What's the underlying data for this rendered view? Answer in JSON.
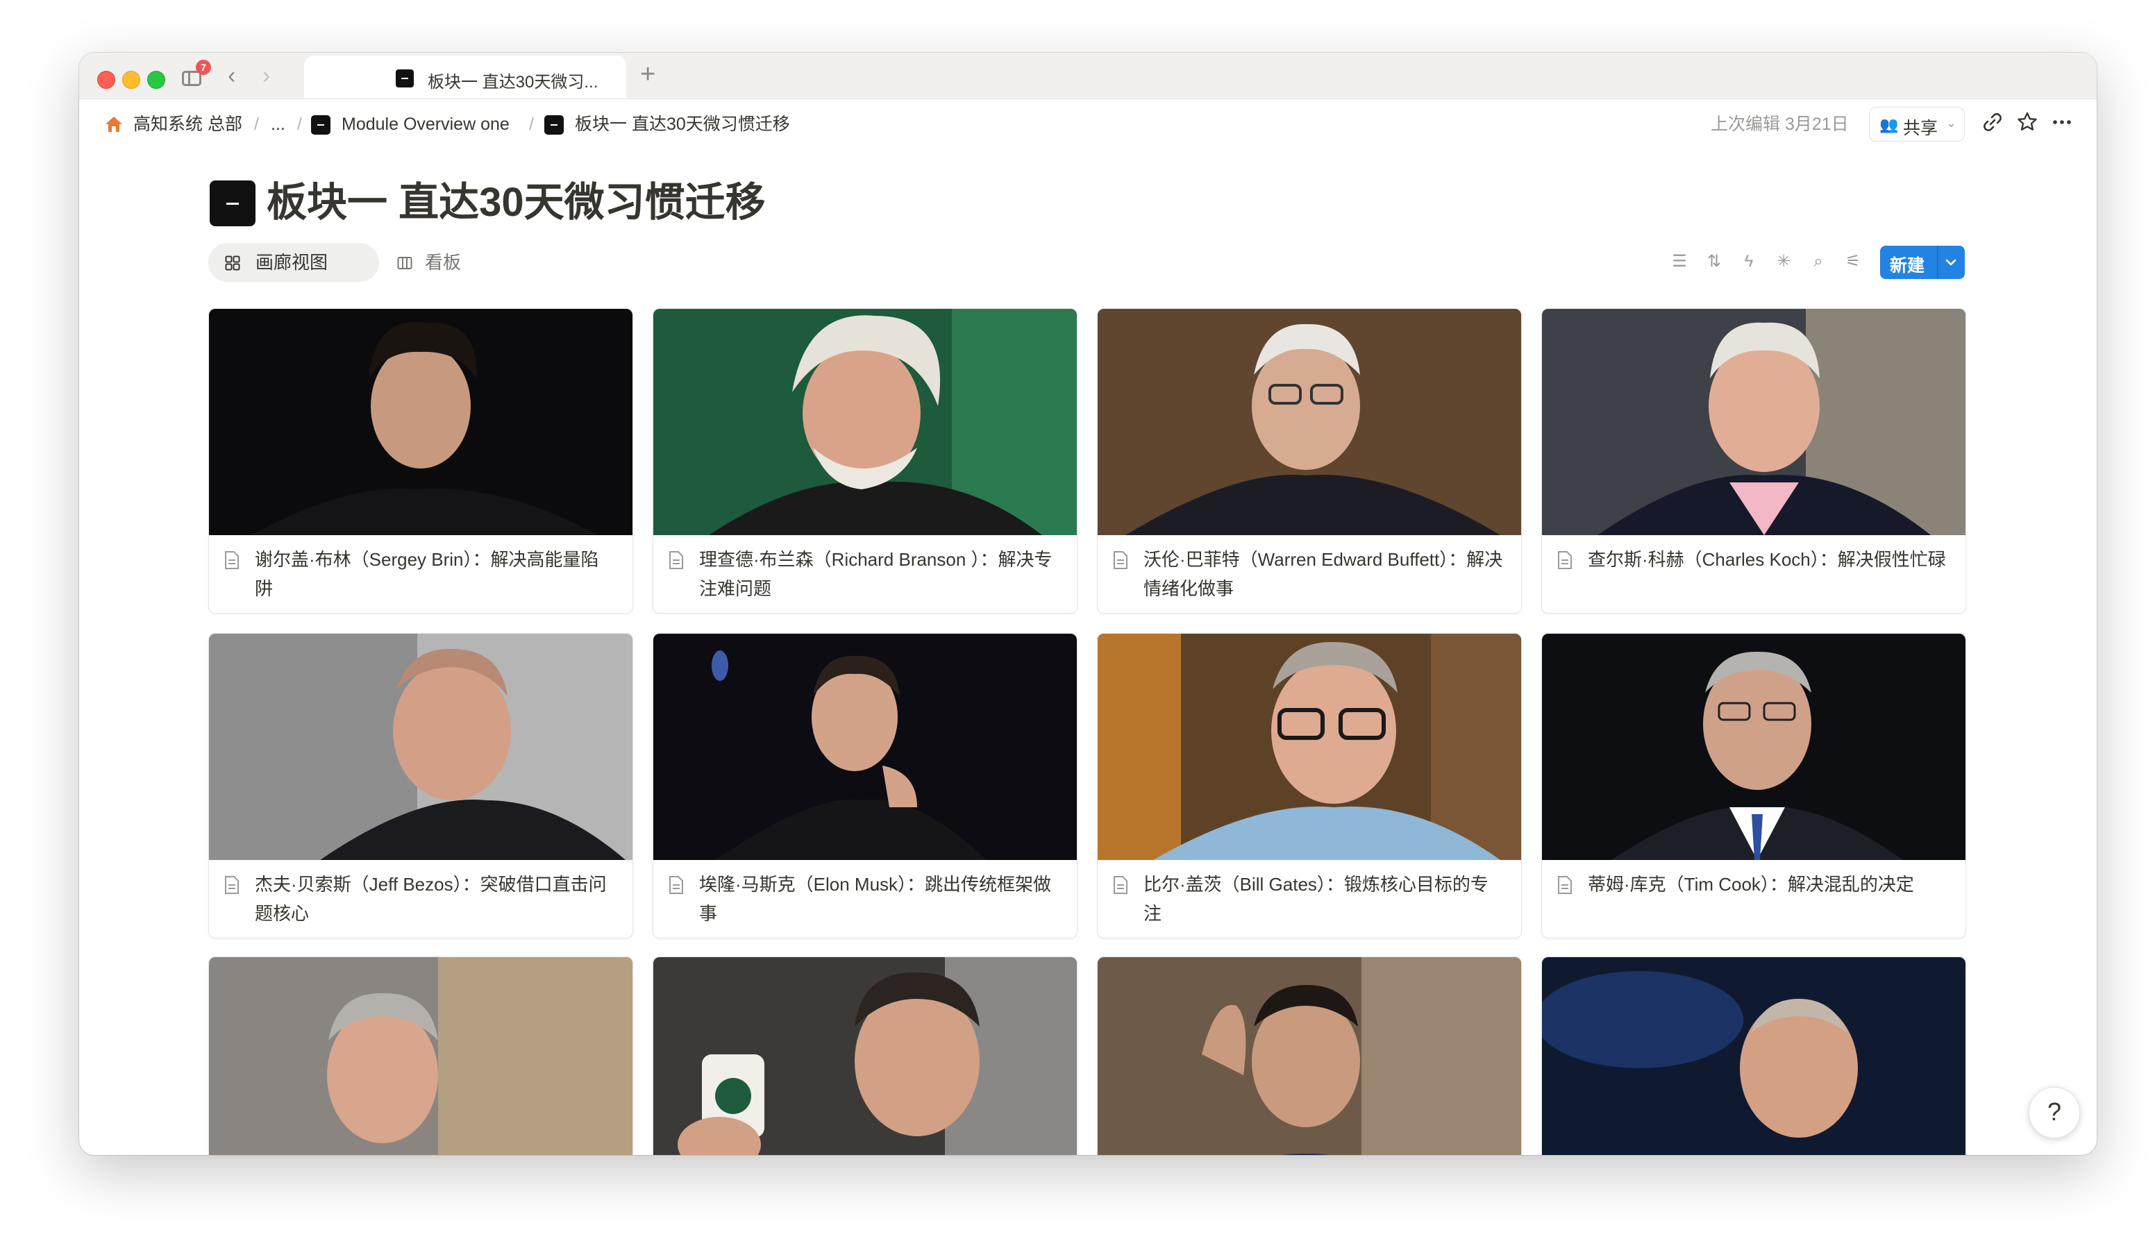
{
  "titlebar": {
    "notification_count": "7",
    "tab_title": "板块一 直达30天微习...",
    "new_tab_label": "+"
  },
  "breadcrumb": {
    "items": [
      "高知系统 总部",
      "...",
      "Module Overview one",
      "板块一 直达30天微习惯迁移"
    ]
  },
  "topbar": {
    "edited": "上次编辑 3月21日",
    "share_label": "共享"
  },
  "page": {
    "title": "板块一 直达30天微习惯迁移",
    "views": [
      "画廊视图",
      "看板"
    ],
    "new_label": "新建"
  },
  "cards": [
    {
      "title": "谢尔盖·布林（Sergey Brin）：解决高能量陷阱"
    },
    {
      "title": "理查德·布兰森（Richard Branson ）：解决专注难问题"
    },
    {
      "title": "沃伦·巴菲特（Warren Edward Buffett）：解决情绪化做事"
    },
    {
      "title": "查尔斯·科赫（Charles Koch）：解决假性忙碌"
    },
    {
      "title": "杰夫·贝索斯（Jeff Bezos）：突破借口直击问题核心"
    },
    {
      "title": "埃隆·马斯克（Elon Musk）：跳出传统框架做事"
    },
    {
      "title": "比尔·盖茨（Bill Gates）：锻炼核心目标的专注"
    },
    {
      "title": "蒂姆·库克（Tim Cook）：解决混乱的决定"
    }
  ],
  "help": {
    "label": "?"
  }
}
